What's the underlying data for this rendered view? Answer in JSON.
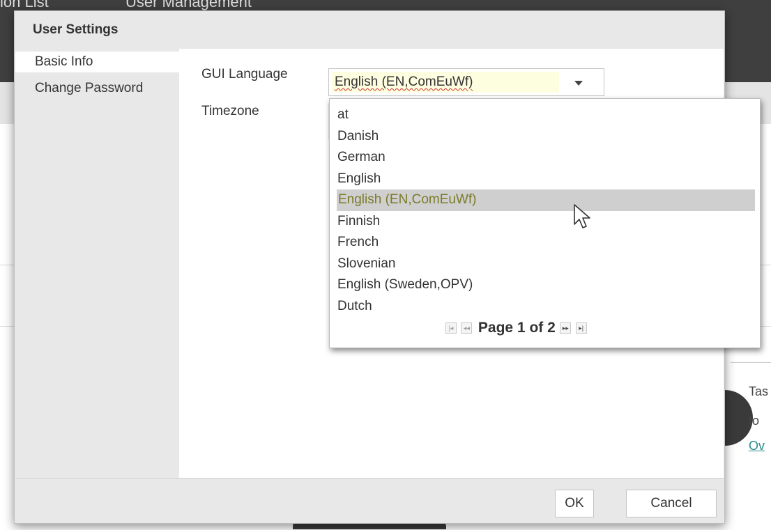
{
  "background": {
    "tabs": [
      "ion List",
      "User Management"
    ],
    "side_text": [
      "Tas",
      "to",
      "Ov"
    ]
  },
  "dialog": {
    "title": "User Settings",
    "sidebar": {
      "items": [
        {
          "label": "Basic Info",
          "active": true
        },
        {
          "label": "Change Password",
          "active": false
        }
      ]
    },
    "fields": {
      "gui_language_label": "GUI Language",
      "gui_language_value": "English (EN,ComEuWf)",
      "timezone_label": "Timezone"
    },
    "buttons": {
      "ok": "OK",
      "cancel": "Cancel"
    }
  },
  "dropdown": {
    "options": [
      "at",
      "Danish",
      "German",
      "English",
      "English (EN,ComEuWf)",
      "Finnish",
      "French",
      "Slovenian",
      "English (Sweden,OPV)",
      "Dutch"
    ],
    "selected_index": 4,
    "pager_text": "Page 1 of 2",
    "pager_buttons": {
      "first": "|◂",
      "prev": "◂◂",
      "next": "▸▸",
      "last": "▸|"
    }
  },
  "colors": {
    "selected_text": "#7a7a2a",
    "selected_bg": "#cfcfcf",
    "dialog_bg": "#e8e8e8",
    "link": "#2a8a8a"
  },
  "icons": {
    "caret": "chevron-down-icon",
    "cursor": "mouse-pointer-icon"
  }
}
